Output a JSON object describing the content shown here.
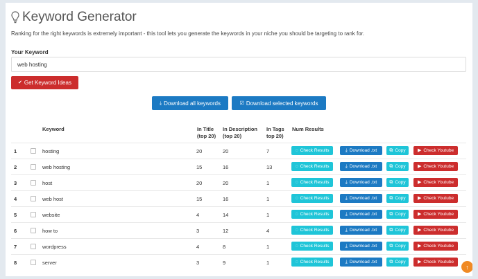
{
  "header": {
    "title": "Keyword Generator",
    "subtitle": "Ranking for the right keywords is extremely important - this tool lets you generate the keywords in your niche you should be targeting to rank for."
  },
  "form": {
    "label": "Your Keyword",
    "value": "web hosting",
    "submit_label": "Get Keyword Ideas"
  },
  "actions": {
    "download_all": "Download all keywords",
    "download_selected": "Download selected keywords"
  },
  "table": {
    "headers": {
      "keyword": "Keyword",
      "in_title_1": "In Title",
      "in_title_2": "(top 20)",
      "in_desc_1": "In Description",
      "in_desc_2": "(top 20)",
      "in_tags_1": "In Tags",
      "in_tags_2": "top 20)",
      "num_results": "Num Results"
    },
    "row_buttons": {
      "check": "Check Results",
      "download": "Download .txt",
      "copy": "Copy",
      "youtube": "Check Youtube"
    },
    "rows": [
      {
        "num": "1",
        "keyword": "hosting",
        "title": "20",
        "desc": "20",
        "tags": "7"
      },
      {
        "num": "2",
        "keyword": "web hosting",
        "title": "15",
        "desc": "16",
        "tags": "13"
      },
      {
        "num": "3",
        "keyword": "host",
        "title": "20",
        "desc": "20",
        "tags": "1"
      },
      {
        "num": "4",
        "keyword": "web host",
        "title": "15",
        "desc": "16",
        "tags": "1"
      },
      {
        "num": "5",
        "keyword": "website",
        "title": "4",
        "desc": "14",
        "tags": "1"
      },
      {
        "num": "6",
        "keyword": "how to",
        "title": "3",
        "desc": "12",
        "tags": "4"
      },
      {
        "num": "7",
        "keyword": "wordpress",
        "title": "4",
        "desc": "8",
        "tags": "1"
      },
      {
        "num": "8",
        "keyword": "server",
        "title": "3",
        "desc": "9",
        "tags": "1"
      }
    ]
  },
  "colors": {
    "danger": "#cc2d2d",
    "primary": "#1c7ac3",
    "info": "#1fc5d8",
    "warning": "#f08a24"
  }
}
